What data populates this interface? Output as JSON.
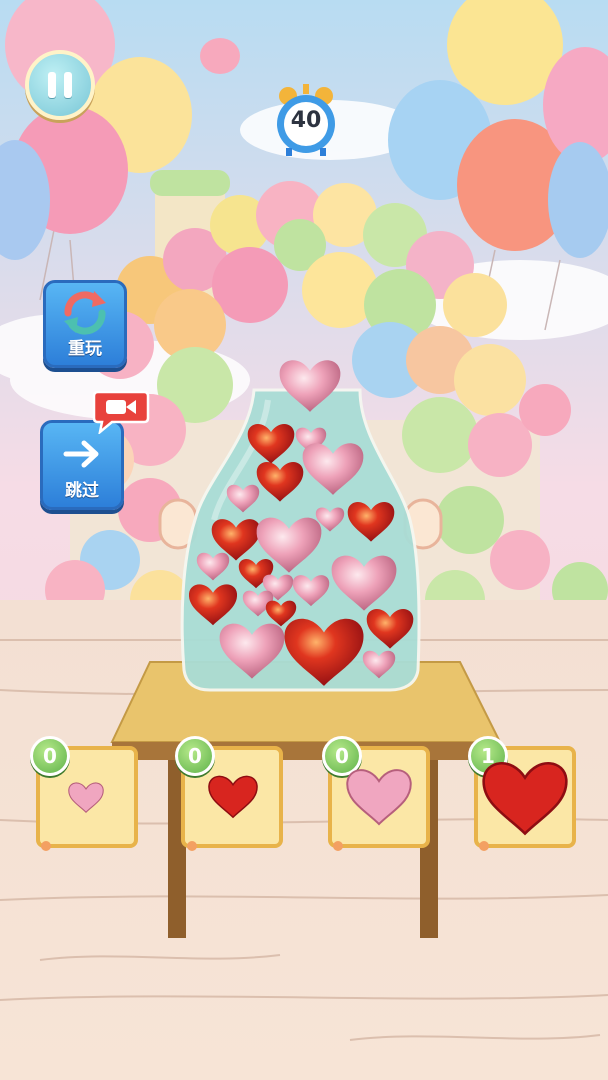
{
  "hud": {
    "pause_icon": "pause-icon",
    "timer_value": "40",
    "timer_icon": "alarm-clock-icon"
  },
  "buttons": {
    "replay_label": "重玩",
    "replay_icon": "refresh-icon",
    "skip_label": "跳过",
    "skip_icon": "arrow-right-icon",
    "skip_badge_icon": "video-camera-icon"
  },
  "slots": [
    {
      "count": "0",
      "heart_type": "pink-crystal-small"
    },
    {
      "count": "0",
      "heart_type": "red-crystal"
    },
    {
      "count": "0",
      "heart_type": "pink-crystal"
    },
    {
      "count": "1",
      "heart_type": "red-crystal-large"
    }
  ],
  "colors": {
    "red_heart": "#d8251f",
    "pink_heart": "#f0a6c0",
    "jar": "#a9ddd6",
    "table": "#e8c46a"
  }
}
